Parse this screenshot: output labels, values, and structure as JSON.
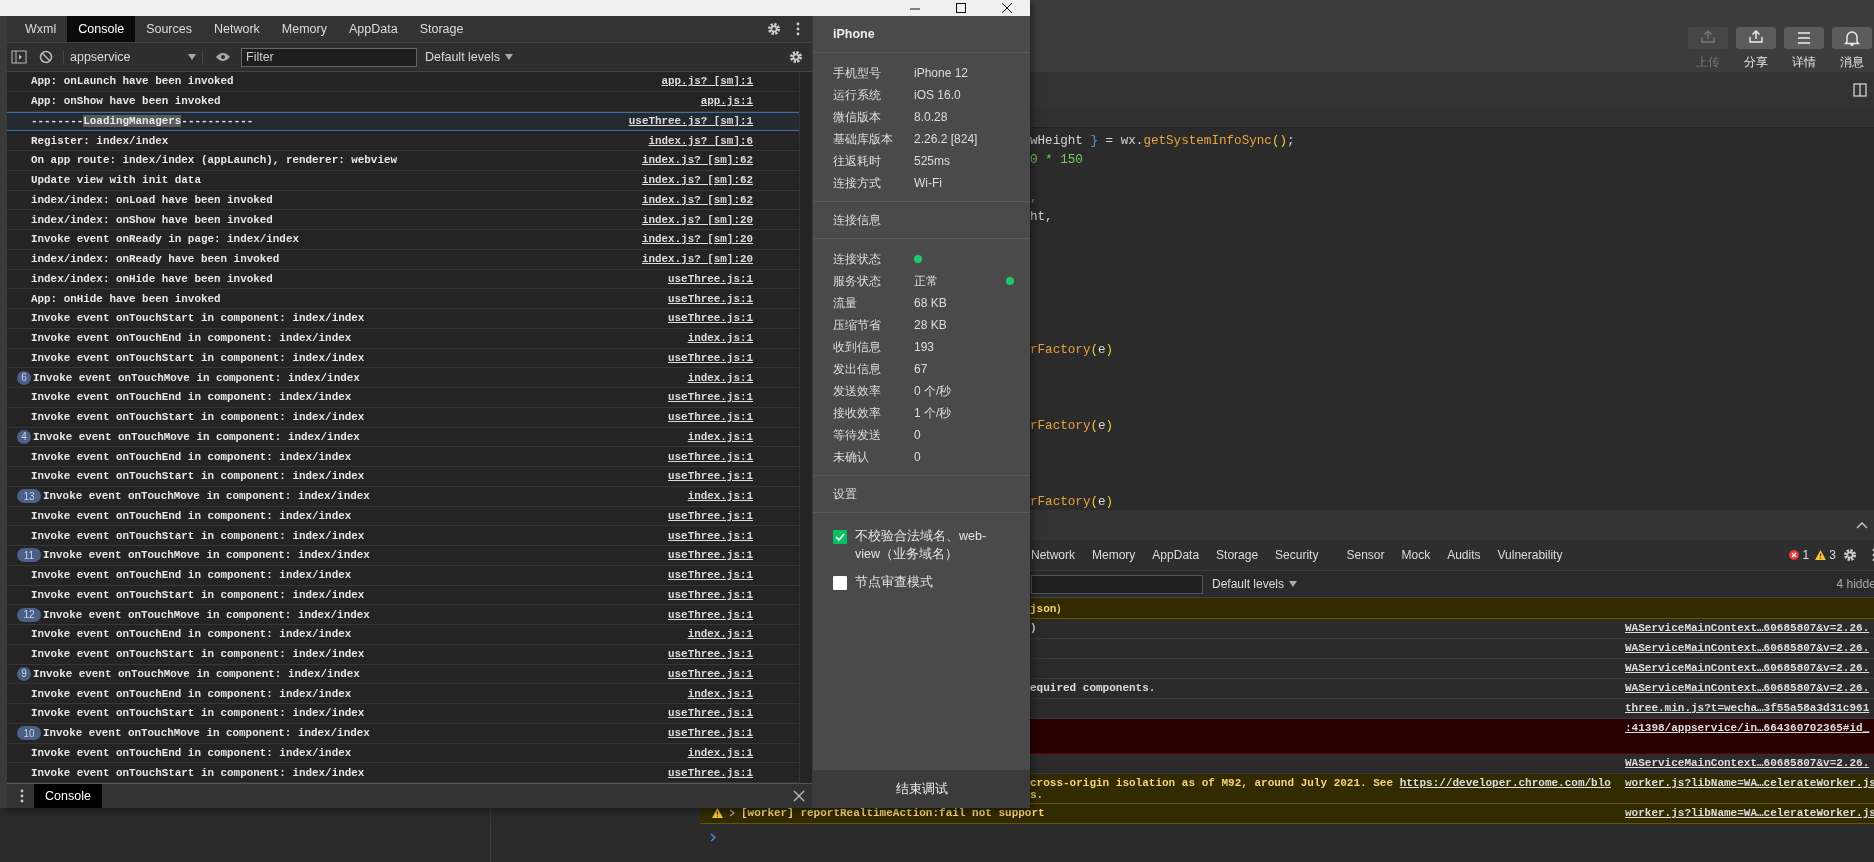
{
  "window": {
    "controls": [
      {
        "kind": "minimize"
      },
      {
        "kind": "maximize"
      },
      {
        "kind": "close"
      }
    ]
  },
  "devtools": {
    "tabs": [
      {
        "label": "Wxml",
        "selected": false
      },
      {
        "label": "Console",
        "selected": true
      },
      {
        "label": "Sources",
        "selected": false
      },
      {
        "label": "Network",
        "selected": false
      },
      {
        "label": "Memory",
        "selected": false
      },
      {
        "label": "AppData",
        "selected": false
      },
      {
        "label": "Storage",
        "selected": false
      }
    ],
    "toolbar": {
      "context": "appservice",
      "filter_placeholder": "Filter",
      "levels": "Default levels"
    },
    "rows": [
      {
        "text": "App: onLaunch have been invoked",
        "link": "app.js? [sm]:1",
        "selected": false
      },
      {
        "text": "App: onShow have been invoked",
        "link": "app.js:1",
        "selected": false
      },
      {
        "segments": [
          {
            "text": "--------",
            "highlighted": false
          },
          {
            "text": "LoadingManagers",
            "highlighted": true
          },
          {
            "text": "-----------",
            "highlighted": false
          }
        ],
        "link": "useThree.js? [sm]:1",
        "selected": true
      },
      {
        "text": "Register: index/index",
        "link": "index.js? [sm]:6",
        "selected": false
      },
      {
        "text": "On app route: index/index (appLaunch), renderer: webview",
        "link": "index.js? [sm]:62",
        "selected": false
      },
      {
        "text": "Update view with init data",
        "link": "index.js? [sm]:62",
        "selected": false
      },
      {
        "text": "index/index: onLoad have been invoked",
        "link": "index.js? [sm]:62",
        "selected": false
      },
      {
        "text": "index/index: onShow have been invoked",
        "link": "index.js? [sm]:20",
        "selected": false
      },
      {
        "text": "Invoke event onReady in page: index/index",
        "link": "index.js? [sm]:20",
        "selected": false
      },
      {
        "text": "index/index: onReady have been invoked",
        "link": "index.js? [sm]:20",
        "selected": false
      },
      {
        "text": "index/index: onHide have been invoked",
        "link": "useThree.js:1",
        "selected": false
      },
      {
        "text": "App: onHide have been invoked",
        "link": "useThree.js:1",
        "selected": false
      },
      {
        "text": "Invoke event onTouchStart in component: index/index",
        "link": "useThree.js:1",
        "selected": false
      },
      {
        "text": "Invoke event onTouchEnd in component: index/index",
        "link": "index.js:1",
        "selected": false
      },
      {
        "text": "Invoke event onTouchStart in component: index/index",
        "link": "useThree.js:1",
        "selected": false
      },
      {
        "count": "6",
        "text": "Invoke event onTouchMove in component: index/index",
        "link": "index.js:1",
        "selected": false
      },
      {
        "text": "Invoke event onTouchEnd in component: index/index",
        "link": "useThree.js:1",
        "selected": false
      },
      {
        "text": "Invoke event onTouchStart in component: index/index",
        "link": "useThree.js:1",
        "selected": false
      },
      {
        "count": "4",
        "text": "Invoke event onTouchMove in component: index/index",
        "link": "index.js:1",
        "selected": false
      },
      {
        "text": "Invoke event onTouchEnd in component: index/index",
        "link": "useThree.js:1",
        "selected": false
      },
      {
        "text": "Invoke event onTouchStart in component: index/index",
        "link": "useThree.js:1",
        "selected": false
      },
      {
        "count": "13",
        "text": "Invoke event onTouchMove in component: index/index",
        "link": "index.js:1",
        "selected": false
      },
      {
        "text": "Invoke event onTouchEnd in component: index/index",
        "link": "useThree.js:1",
        "selected": false
      },
      {
        "text": "Invoke event onTouchStart in component: index/index",
        "link": "useThree.js:1",
        "selected": false
      },
      {
        "count": "11",
        "text": "Invoke event onTouchMove in component: index/index",
        "link": "useThree.js:1",
        "selected": false
      },
      {
        "text": "Invoke event onTouchEnd in component: index/index",
        "link": "useThree.js:1",
        "selected": false
      },
      {
        "text": "Invoke event onTouchStart in component: index/index",
        "link": "useThree.js:1",
        "selected": false
      },
      {
        "count": "12",
        "text": "Invoke event onTouchMove in component: index/index",
        "link": "useThree.js:1",
        "selected": false
      },
      {
        "text": "Invoke event onTouchEnd in component: index/index",
        "link": "index.js:1",
        "selected": false
      },
      {
        "text": "Invoke event onTouchStart in component: index/index",
        "link": "useThree.js:1",
        "selected": false
      },
      {
        "count": "9",
        "text": "Invoke event onTouchMove in component: index/index",
        "link": "useThree.js:1",
        "selected": false
      },
      {
        "text": "Invoke event onTouchEnd in component: index/index",
        "link": "index.js:1",
        "selected": false
      },
      {
        "text": "Invoke event onTouchStart in component: index/index",
        "link": "useThree.js:1",
        "selected": false
      },
      {
        "count": "10",
        "text": "Invoke event onTouchMove in component: index/index",
        "link": "useThree.js:1",
        "selected": false
      },
      {
        "text": "Invoke event onTouchEnd in component: index/index",
        "link": "index.js:1",
        "selected": false
      },
      {
        "text": "Invoke event onTouchStart in component: index/index",
        "link": "useThree.js:1",
        "selected": false
      }
    ],
    "drawer": {
      "tabs": [
        {
          "label": "Console",
          "selected": true
        }
      ]
    }
  },
  "device_panel": {
    "title": "iPhone",
    "info": [
      {
        "label": "手机型号",
        "value": "iPhone 12"
      },
      {
        "label": "运行系统",
        "value": "iOS 16.0"
      },
      {
        "label": "微信版本",
        "value": "8.0.28"
      },
      {
        "label": "基础库版本",
        "value": "2.26.2 [824]"
      },
      {
        "label": "往返耗时",
        "value": "525ms"
      },
      {
        "label": "连接方式",
        "value": "Wi-Fi"
      }
    ],
    "connection_title": "连接信息",
    "connection": [
      {
        "label": "连接状态",
        "kind": "dot"
      },
      {
        "label": "服务状态",
        "value": "正常",
        "kind": "text-dot"
      },
      {
        "label": "流量",
        "value": "68 KB",
        "kind": "text"
      },
      {
        "label": "压缩节省",
        "value": "28 KB",
        "kind": "text"
      },
      {
        "label": "收到信息",
        "value": "193",
        "kind": "text"
      },
      {
        "label": "发出信息",
        "value": "67",
        "kind": "text"
      },
      {
        "label": "发送效率",
        "value": "0 个/秒",
        "kind": "text"
      },
      {
        "label": "接收效率",
        "value": "1 个/秒",
        "kind": "text"
      },
      {
        "label": "等待发送",
        "value": "0",
        "kind": "text"
      },
      {
        "label": "未确认",
        "value": "0",
        "kind": "text"
      }
    ],
    "settings_title": "设置",
    "settings": [
      {
        "label": "不校验合法域名、web-view（业务域名）",
        "checked": true
      },
      {
        "label": "节点审查模式",
        "checked": false
      }
    ],
    "end_button": "结束调试"
  },
  "ide": {
    "toolbar": [
      {
        "label": "上传",
        "kind": "upload",
        "disabled": true
      },
      {
        "label": "分享",
        "kind": "upload",
        "disabled": false
      },
      {
        "label": "详情",
        "kind": "menu",
        "disabled": false
      },
      {
        "label": "消息",
        "kind": "bell",
        "disabled": false
      }
    ],
    "code": [
      {
        "kind": "code",
        "tokens": [
          {
            "text": "wHeight ",
            "kind": "plain"
          },
          {
            "text": "}",
            "kind": "brace"
          },
          {
            "text": " = wx.",
            "kind": "plain"
          },
          {
            "text": "getSystemInfoSync",
            "kind": "function"
          },
          {
            "text": "()",
            "kind": "paren"
          },
          {
            "text": ";",
            "kind": "plain"
          }
        ]
      },
      {
        "kind": "code",
        "tokens": [
          {
            "text": "0 * 150",
            "kind": "number"
          }
        ]
      },
      {
        "kind": "blank"
      },
      {
        "kind": "code",
        "tokens": [
          {
            "text": ",",
            "kind": "brace"
          }
        ]
      },
      {
        "kind": "code",
        "tokens": [
          {
            "text": "ht,",
            "kind": "plain"
          }
        ]
      },
      {
        "kind": "blank"
      },
      {
        "kind": "blank"
      },
      {
        "kind": "blank"
      },
      {
        "kind": "blank"
      },
      {
        "kind": "blank"
      },
      {
        "kind": "blank"
      },
      {
        "kind": "code",
        "tokens": [
          {
            "text": "rFactory",
            "kind": "function"
          },
          {
            "text": "(",
            "kind": "paren"
          },
          {
            "text": "e",
            "kind": "plain"
          },
          {
            "text": ")",
            "kind": "paren"
          }
        ]
      },
      {
        "kind": "blank"
      },
      {
        "kind": "blank"
      },
      {
        "kind": "blank"
      },
      {
        "kind": "code",
        "tokens": [
          {
            "text": "rFactory",
            "kind": "function"
          },
          {
            "text": "(",
            "kind": "paren"
          },
          {
            "text": "e",
            "kind": "plain"
          },
          {
            "text": ")",
            "kind": "paren"
          }
        ]
      },
      {
        "kind": "blank"
      },
      {
        "kind": "blank"
      },
      {
        "kind": "blank"
      },
      {
        "kind": "code",
        "tokens": [
          {
            "text": "rFactory",
            "kind": "function"
          },
          {
            "text": "(",
            "kind": "paren"
          },
          {
            "text": "e",
            "kind": "plain"
          },
          {
            "text": ")",
            "kind": "paren"
          }
        ]
      }
    ],
    "console": {
      "tabs": [
        {
          "label": "Network",
          "selected": false
        },
        {
          "label": "Memory",
          "selected": false
        },
        {
          "label": "AppData",
          "selected": false
        },
        {
          "label": "Storage",
          "selected": false
        },
        {
          "label": "Security",
          "selected": false
        },
        {
          "label": "Sensor",
          "selected": false
        },
        {
          "label": "Mock",
          "selected": false
        },
        {
          "label": "Audits",
          "selected": false
        },
        {
          "label": "Vulnerability",
          "selected": false
        }
      ],
      "errors": "1",
      "warnings": "3",
      "levels": "Default levels",
      "hidden": "4 hidde",
      "rows": [
        {
          "kind": "warning",
          "text": "json）"
        },
        {
          "kind": "info",
          "text": ")",
          "link": "WAServiceMainContext…60685807&v=2.26."
        },
        {
          "kind": "info",
          "link": "WAServiceMainContext…60685807&v=2.26."
        },
        {
          "kind": "info",
          "link": "WAServiceMainContext…60685807&v=2.26."
        },
        {
          "kind": "info",
          "text": "equired components.",
          "link": "WAServiceMainContext…60685807&v=2.26."
        },
        {
          "kind": "info",
          "link": "three.min.js?t=wecha…3f55a58a3d31c961"
        },
        {
          "kind": "error",
          "link": ":41398/appservice/in…664360702365#id_"
        },
        {
          "kind": "info",
          "link": "WAServiceMainContext…60685807&v=2.26."
        },
        {
          "kind": "warning",
          "text": "cross-origin isolation as of M92, around July 2021. See ",
          "inline_link": "https://developer.chrome.com/blo",
          "text_after": "s.",
          "link": "worker.js?libName=WA…celerateWorker.js"
        }
      ],
      "footer_row": {
        "kind": "warning",
        "text": "[worker] reportRealtimeAction:fail not support",
        "link": "worker.js?libName=WA…celerateWorker.js"
      }
    }
  }
}
